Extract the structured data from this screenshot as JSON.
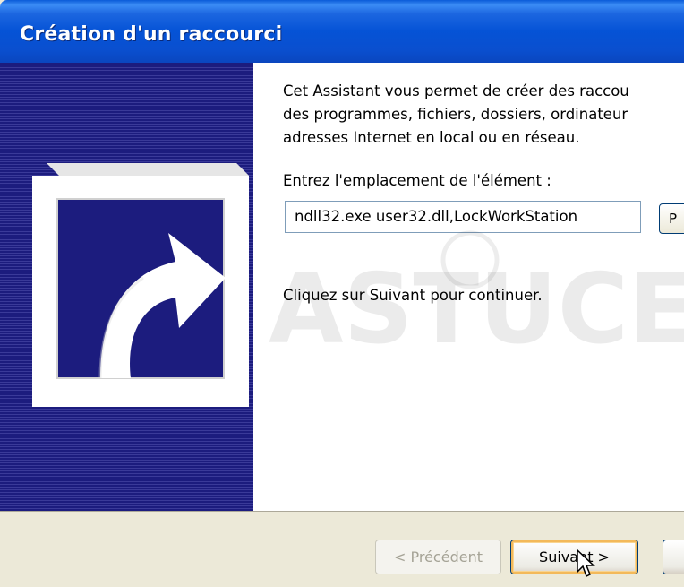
{
  "window": {
    "title": "Création d'un raccourci"
  },
  "intro": {
    "line1": "Cet Assistant vous permet de créer des raccou",
    "line2": "des programmes, fichiers, dossiers, ordinateur",
    "line3": "adresses Internet en local ou en réseau."
  },
  "location": {
    "label": "Entrez l'emplacement de l'élément :",
    "value": "ndll32.exe user32.dll,LockWorkStation",
    "browse_label": "P"
  },
  "hint": "Cliquez sur Suivant pour continuer.",
  "watermark": "ASTUCES",
  "buttons": {
    "prev": "< Précédent",
    "next": "Suivant >",
    "cancel": ""
  },
  "colors": {
    "titlebar": "#0553d6",
    "side_panel": "#1c1c7e",
    "default_button_highlight": "#f3b95a"
  },
  "icons": {
    "shortcut": "shortcut-arrow-icon",
    "cursor": "mouse-cursor-icon"
  }
}
